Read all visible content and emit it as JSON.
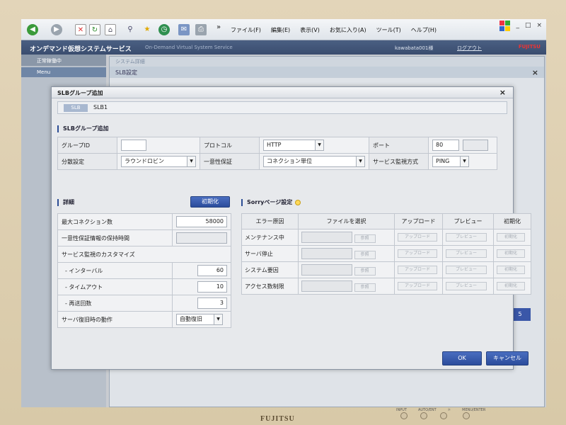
{
  "browser": {
    "menu": [
      "ファイル(F)",
      "編集(E)",
      "表示(V)",
      "お気に入り(A)",
      "ツール(T)",
      "ヘルプ(H)"
    ],
    "more": "»",
    "window_controls": [
      "_",
      "□",
      "×"
    ]
  },
  "app": {
    "title": "オンデマンド仮想システムサービス",
    "subtitle": "On-Demand Virtual System Service",
    "user": "kawabata001様",
    "logout": "ログアウト",
    "vendor": "FUJITSU"
  },
  "sidebar": {
    "status": "正常稼働中",
    "menu": "Menu"
  },
  "bg_window": {
    "title": "システム詳細",
    "subtitle": "SLB設定",
    "close": "×",
    "button": "5"
  },
  "dialog": {
    "title": "SLBグループ追加",
    "close": "×",
    "slb_tag": "SLB",
    "slb_name": "SLB1",
    "section_group": "SLBグループ追加",
    "row1": {
      "group_id_label": "グループID",
      "group_id_value": "",
      "protocol_label": "プロトコル",
      "protocol_value": "HTTP",
      "port_label": "ポート",
      "port_value": "80",
      "port_value2": ""
    },
    "row2": {
      "dist_label": "分散設定",
      "dist_value": "ラウンドロビン",
      "persist_label": "一意性保証",
      "persist_value": "コネクション単位",
      "monitor_label": "サービス監視方式",
      "monitor_value": "PING"
    },
    "section_detail": "詳細",
    "init_button": "初期化",
    "details": [
      {
        "label": "最大コネクション数",
        "value": "58000"
      },
      {
        "label": "一意性保証情報の保持時間",
        "value": ""
      },
      {
        "label": "サービス監視のカスタマイズ",
        "value": null
      },
      {
        "label": "- インターバル",
        "value": "60"
      },
      {
        "label": "- タイムアウト",
        "value": "10"
      },
      {
        "label": "- 再送回数",
        "value": "3"
      }
    ],
    "recover_label": "サーバ復旧時の動作",
    "recover_value": "自動復旧",
    "section_sorry": "Sorryページ設定",
    "sorry_headers": [
      "エラー原因",
      "ファイルを選択",
      "アップロード",
      "プレビュー",
      "初期化"
    ],
    "sorry_rows": [
      "メンテナンス中",
      "サーバ停止",
      "システム要因",
      "アクセス数制限"
    ],
    "browse_label": "参照",
    "upload_label": "アップロード",
    "preview_label": "プレビュー",
    "reset_label": "初期化",
    "ok": "OK",
    "cancel": "キャンセル"
  },
  "monitor": {
    "brand": "FUJITSU",
    "controls": [
      "INPUT",
      "AUTO/ENT",
      "☼",
      "MENU/ENTER"
    ]
  },
  "colors": {
    "accent": "#2b4c9c",
    "header": "#3a4d6f"
  }
}
